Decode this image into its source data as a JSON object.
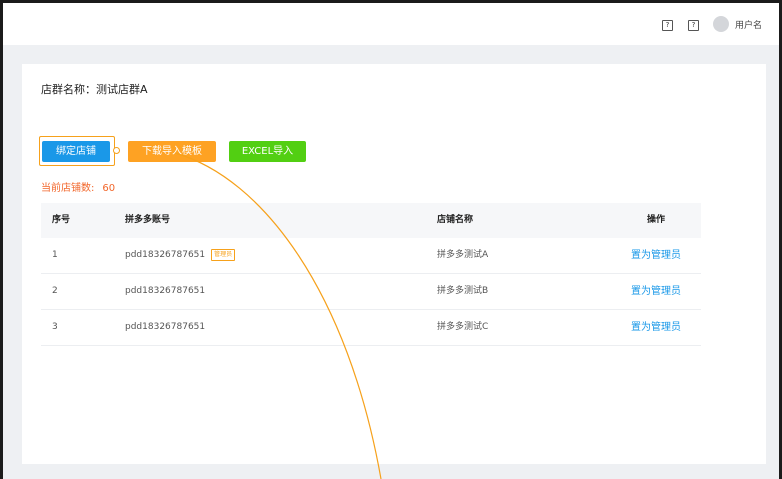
{
  "header": {
    "help_icon_1": "?",
    "help_icon_2": "?",
    "username": "用户名"
  },
  "page": {
    "group_label": "店群名称：测试店群A"
  },
  "toolbar": {
    "bind_label": "绑定店铺",
    "template_label": "下载导入模板",
    "excel_label": "EXCEL导入"
  },
  "summary": {
    "shop_count_label": "当前店铺数:",
    "shop_count_value": "60"
  },
  "table": {
    "columns": [
      "序号",
      "拼多多账号",
      "店铺名称",
      "操作"
    ],
    "rows": [
      {
        "index": "1",
        "account": "pdd18326787651",
        "badge": "管理员",
        "shop": "拼多多测试A",
        "action": "置为管理员"
      },
      {
        "index": "2",
        "account": "pdd18326787651",
        "badge": "",
        "shop": "拼多多测试B",
        "action": "置为管理员"
      },
      {
        "index": "3",
        "account": "pdd18326787651",
        "badge": "",
        "shop": "拼多多测试C",
        "action": "置为管理员"
      }
    ]
  },
  "colors": {
    "primary": "#1a98e8",
    "warning": "#fea223",
    "success": "#52cf12",
    "danger_text": "#f2662a"
  }
}
